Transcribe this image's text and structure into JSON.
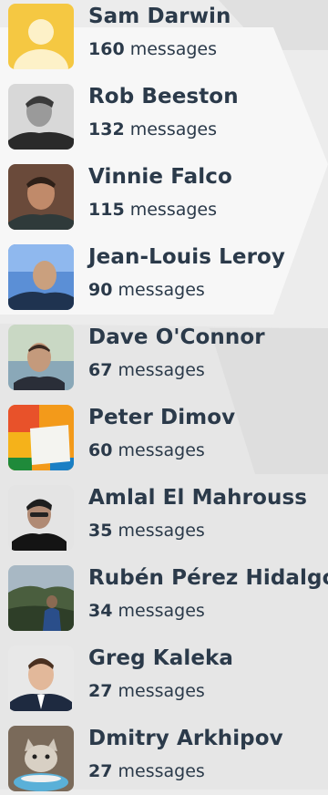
{
  "unit_label": "messages",
  "people": [
    {
      "name": "Sam Darwin",
      "count": "160",
      "avatar": "default-avatar-icon"
    },
    {
      "name": "Rob Beeston",
      "count": "132",
      "avatar": "photo"
    },
    {
      "name": "Vinnie Falco",
      "count": "115",
      "avatar": "photo"
    },
    {
      "name": "Jean-Louis Leroy",
      "count": "90",
      "avatar": "photo"
    },
    {
      "name": "Dave O'Connor",
      "count": "67",
      "avatar": "photo"
    },
    {
      "name": "Peter Dimov",
      "count": "60",
      "avatar": "tile-logo"
    },
    {
      "name": "Amlal El Mahrouss",
      "count": "35",
      "avatar": "photo"
    },
    {
      "name": "Rubén Pérez Hidalgo",
      "count": "34",
      "avatar": "photo"
    },
    {
      "name": "Greg Kaleka",
      "count": "27",
      "avatar": "photo"
    },
    {
      "name": "Dmitry Arkhipov",
      "count": "27",
      "avatar": "photo"
    }
  ],
  "colors": {
    "text": "#2b3a4a",
    "background": "#ececec",
    "default_avatar_bg": "#f5c842"
  }
}
